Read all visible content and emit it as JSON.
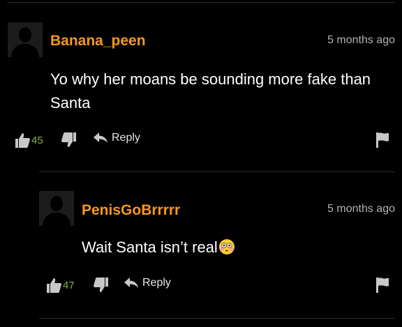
{
  "comments": [
    {
      "username": "Banana_peen",
      "timestamp": "5 months ago",
      "text": "Yo why her moans be sounding more fake than Santa",
      "likes": "45",
      "reply_label": "Reply",
      "avatar_icon": "default-avatar-silhouette",
      "like_icon": "thumbs-up-icon",
      "dislike_icon": "thumbs-down-icon",
      "reply_icon": "reply-arrow-icon",
      "flag_icon": "flag-icon"
    },
    {
      "username": "PenisGoBrrrrr",
      "timestamp": "5 months ago",
      "text": "Wait Santa isn’t real",
      "emoji": "flushed-face-emoji",
      "likes": "47",
      "reply_label": "Reply",
      "avatar_icon": "default-avatar-silhouette",
      "like_icon": "thumbs-up-icon",
      "dislike_icon": "thumbs-down-icon",
      "reply_icon": "reply-arrow-icon",
      "flag_icon": "flag-icon"
    }
  ],
  "colors": {
    "background": "#000000",
    "username": "#f7981d",
    "vote_count": "#8cb043",
    "timestamp": "#b3b3b3",
    "icon": "#c8c8c8",
    "divider": "#2b2b2b"
  }
}
